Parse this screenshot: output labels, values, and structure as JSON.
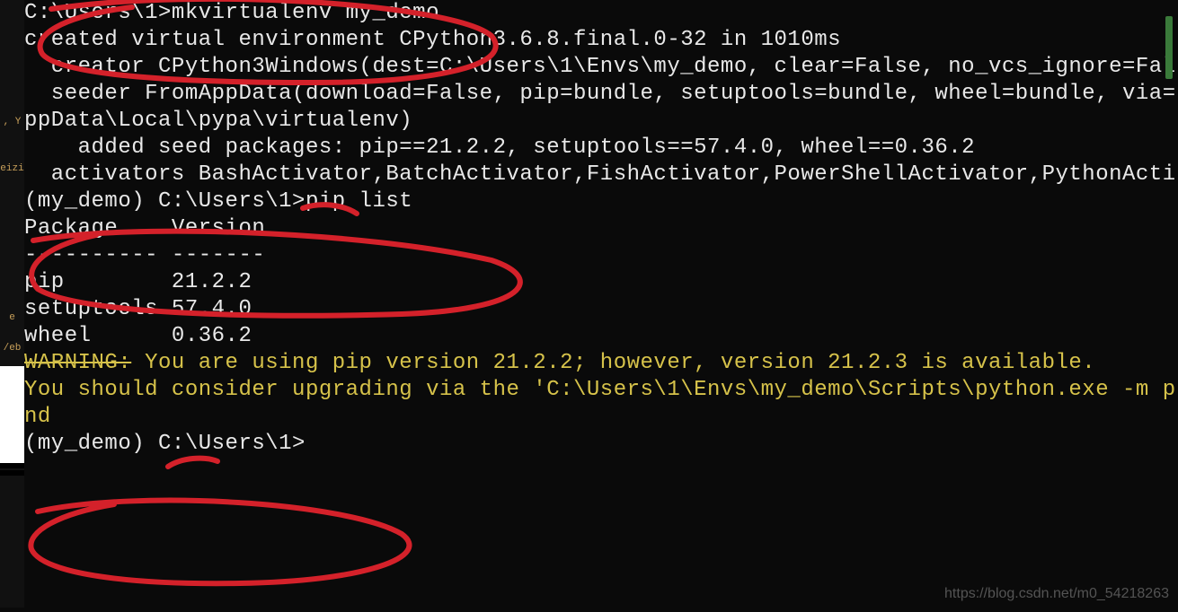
{
  "left_strip": {
    "labels": [
      ", Y",
      "eizi",
      "e",
      "/eb"
    ]
  },
  "terminal": {
    "lines": [
      {
        "cls": "",
        "txt": ""
      },
      {
        "cls": "",
        "txt": "C:\\Users\\1>mkvirtualenv my_demo"
      },
      {
        "cls": "",
        "txt": "created virtual environment CPython3.6.8.final.0-32 in 1010ms"
      },
      {
        "cls": "",
        "txt": "  creator CPython3Windows(dest=C:\\Users\\1\\Envs\\my_demo, clear=False, no_vcs_ignore=Fal"
      },
      {
        "cls": "",
        "txt": "  seeder FromAppData(download=False, pip=bundle, setuptools=bundle, wheel=bundle, via="
      },
      {
        "cls": "",
        "txt": "ppData\\Local\\pypa\\virtualenv)"
      },
      {
        "cls": "",
        "txt": "    added seed packages: pip==21.2.2, setuptools==57.4.0, wheel==0.36.2"
      },
      {
        "cls": "",
        "txt": "  activators BashActivator,BatchActivator,FishActivator,PowerShellActivator,PythonActi"
      },
      {
        "cls": "",
        "txt": ""
      },
      {
        "cls": "",
        "txt": "(my_demo) C:\\Users\\1>pip list"
      },
      {
        "cls": "",
        "txt": "Package    Version"
      },
      {
        "cls": "",
        "txt": "---------- -------"
      },
      {
        "cls": "",
        "txt": "pip        21.2.2"
      },
      {
        "cls": "",
        "txt": "setuptools 57.4.0"
      },
      {
        "cls": "",
        "txt": "wheel      0.36.2"
      },
      {
        "cls": "yellow",
        "txt": "WARNING: You are using pip version 21.2.2; however, version 21.2.3 is available."
      },
      {
        "cls": "yellow",
        "txt": "You should consider upgrading via the 'C:\\Users\\1\\Envs\\my_demo\\Scripts\\python.exe -m p"
      },
      {
        "cls": "yellow",
        "txt": "nd"
      },
      {
        "cls": "",
        "txt": ""
      },
      {
        "cls": "",
        "txt": "(my_demo) C:\\Users\\1>"
      }
    ],
    "warning_strike_text": "WARNING:"
  },
  "pip_list": {
    "header": [
      "Package",
      "Version"
    ],
    "rows": [
      {
        "package": "pip",
        "version": "21.2.2"
      },
      {
        "package": "setuptools",
        "version": "57.4.0"
      },
      {
        "package": "wheel",
        "version": "0.36.2"
      }
    ]
  },
  "commands": {
    "cmd1": "mkvirtualenv my_demo",
    "cmd2": "pip list",
    "prompt1": "C:\\Users\\1>",
    "prompt2": "(my_demo) C:\\Users\\1>"
  },
  "watermark": "https://blog.csdn.net/m0_54218263",
  "annotation_color": "#d4212a"
}
